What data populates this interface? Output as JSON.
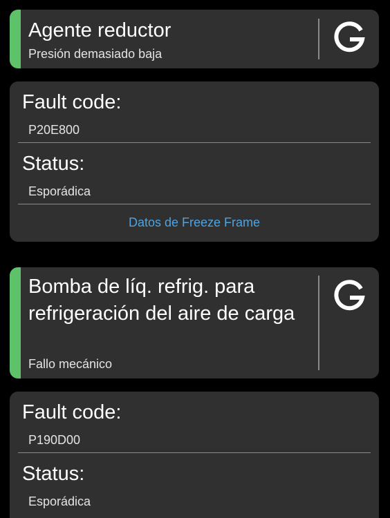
{
  "faults": [
    {
      "title": "Agente reductor",
      "subtitle": "Presión demasiado baja",
      "code_label": "Fault code:",
      "code": "P20E800",
      "status_label": "Status:",
      "status": "Esporádica",
      "link": "Datos de Freeze Frame"
    },
    {
      "title": "Bomba de líq. refrig. para refrigeración del aire de carga",
      "subtitle": "Fallo mecánico",
      "code_label": "Fault code:",
      "code": "P190D00",
      "status_label": "Status:",
      "status": "Esporádica"
    }
  ],
  "colors": {
    "accent": "#5ec26a",
    "card": "#303030",
    "link": "#4fa3e0",
    "background": "#000000"
  },
  "icons": {
    "brand": "google-g-icon"
  }
}
